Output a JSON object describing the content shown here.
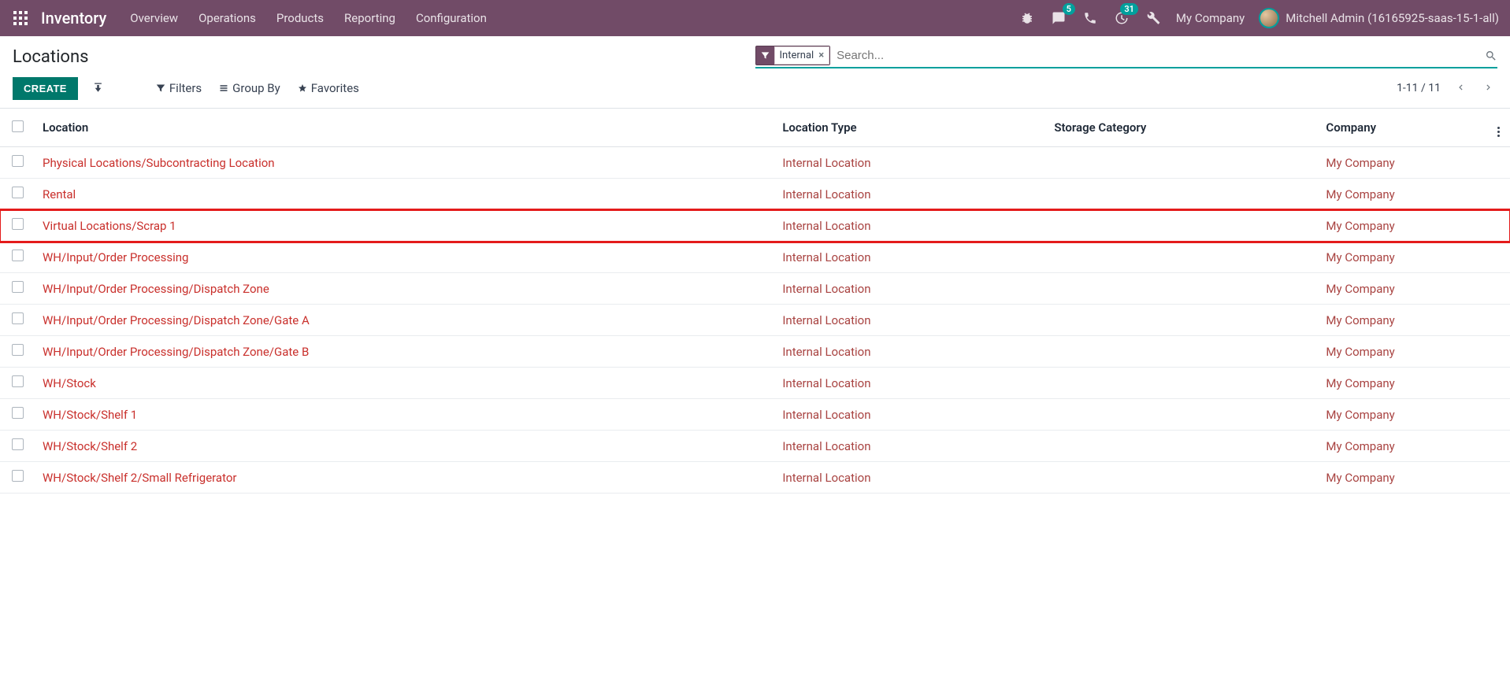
{
  "navbar": {
    "brand": "Inventory",
    "menus": [
      "Overview",
      "Operations",
      "Products",
      "Reporting",
      "Configuration"
    ],
    "messages_badge": "5",
    "activities_badge": "31",
    "company": "My Company",
    "user": "Mitchell Admin (16165925-saas-15-1-all)"
  },
  "control_panel": {
    "title": "Locations",
    "search_tag": "Internal",
    "search_placeholder": "Search...",
    "create_label": "CREATE",
    "filters_label": "Filters",
    "groupby_label": "Group By",
    "favorites_label": "Favorites",
    "pager": "1-11 / 11"
  },
  "table": {
    "columns": {
      "location": "Location",
      "type": "Location Type",
      "storage": "Storage Category",
      "company": "Company"
    },
    "rows": [
      {
        "location": "Physical Locations/Subcontracting Location",
        "type": "Internal Location",
        "storage": "",
        "company": "My Company",
        "highlight": false
      },
      {
        "location": "Rental",
        "type": "Internal Location",
        "storage": "",
        "company": "My Company",
        "highlight": false
      },
      {
        "location": "Virtual Locations/Scrap 1",
        "type": "Internal Location",
        "storage": "",
        "company": "My Company",
        "highlight": true
      },
      {
        "location": "WH/Input/Order Processing",
        "type": "Internal Location",
        "storage": "",
        "company": "My Company",
        "highlight": false
      },
      {
        "location": "WH/Input/Order Processing/Dispatch Zone",
        "type": "Internal Location",
        "storage": "",
        "company": "My Company",
        "highlight": false
      },
      {
        "location": "WH/Input/Order Processing/Dispatch Zone/Gate A",
        "type": "Internal Location",
        "storage": "",
        "company": "My Company",
        "highlight": false
      },
      {
        "location": "WH/Input/Order Processing/Dispatch Zone/Gate B",
        "type": "Internal Location",
        "storage": "",
        "company": "My Company",
        "highlight": false
      },
      {
        "location": "WH/Stock",
        "type": "Internal Location",
        "storage": "",
        "company": "My Company",
        "highlight": false
      },
      {
        "location": "WH/Stock/Shelf 1",
        "type": "Internal Location",
        "storage": "",
        "company": "My Company",
        "highlight": false
      },
      {
        "location": "WH/Stock/Shelf 2",
        "type": "Internal Location",
        "storage": "",
        "company": "My Company",
        "highlight": false
      },
      {
        "location": "WH/Stock/Shelf 2/Small Refrigerator",
        "type": "Internal Location",
        "storage": "",
        "company": "My Company",
        "highlight": false
      }
    ]
  }
}
